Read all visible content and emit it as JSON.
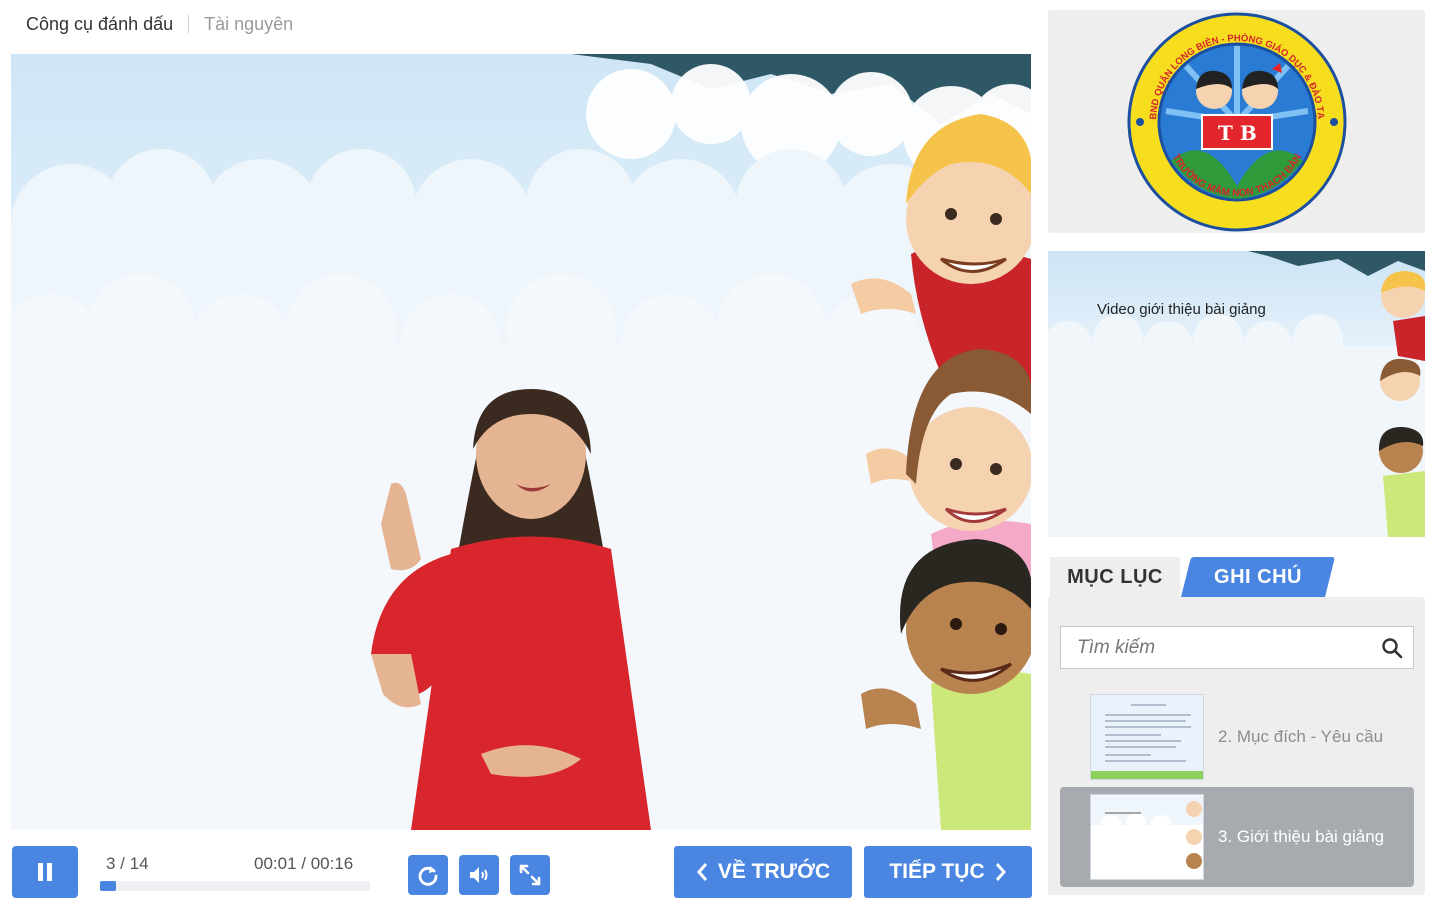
{
  "top_tabs": {
    "markup_tool": "Công cụ đánh dấu",
    "resources": "Tài nguyên"
  },
  "player": {
    "slide_counter": "3 / 14",
    "time": "00:01 / 00:16",
    "progress": 0.06,
    "prev_label": "VỀ TRƯỚC",
    "next_label": "TIẾP TỤC"
  },
  "logo": {
    "ring_top": "UBND QUẬN LONG BIÊN - PHÒNG GIÁO DỤC & ĐÀO TẠO",
    "ring_bottom": "TRƯỜNG MẦM NON THẠCH BÀN",
    "letters": "T B"
  },
  "preview": {
    "title": "Video giới thiệu bài giảng"
  },
  "sidebar": {
    "tabs": [
      {
        "label": "MỤC LỤC"
      },
      {
        "label": "GHI CHÚ"
      }
    ],
    "search": {
      "placeholder": "Tìm kiếm",
      "value": ""
    },
    "items": [
      {
        "label": "2. Mục đích - Yêu cầu",
        "active": false
      },
      {
        "label": "3. Giới thiệu bài giảng",
        "active": true
      }
    ]
  },
  "colors": {
    "accent": "#4a86e1",
    "active_item": "#a7abb0",
    "panel": "#eeeeee"
  }
}
